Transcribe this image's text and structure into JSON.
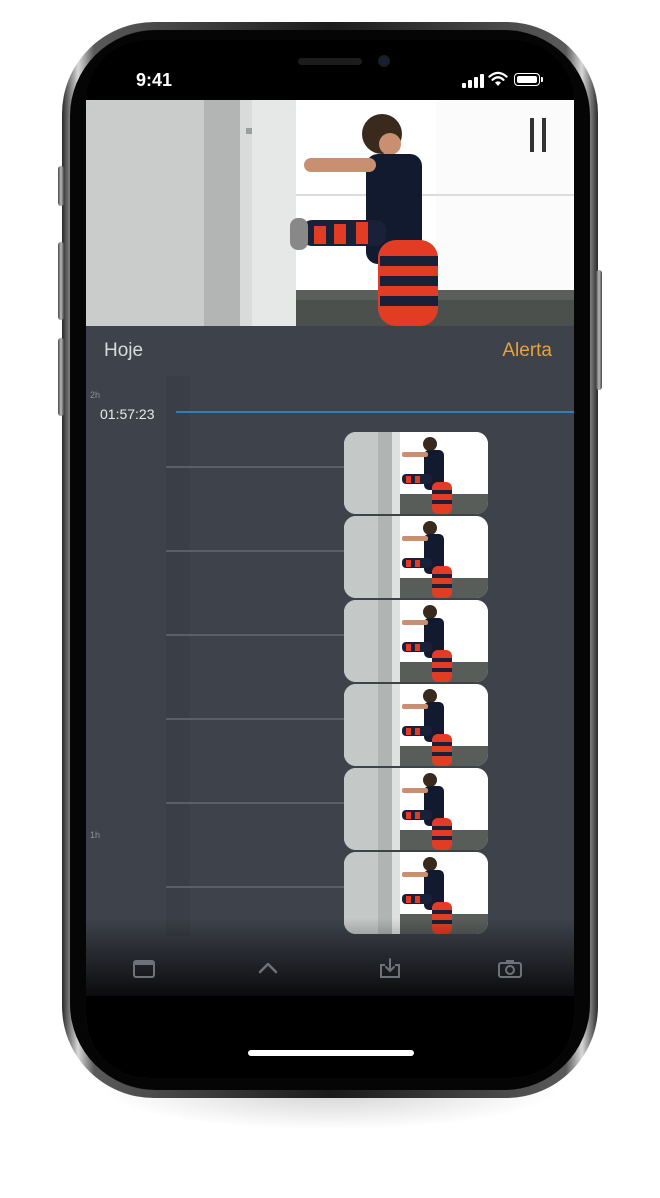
{
  "status_bar": {
    "time": "9:41"
  },
  "timeline": {
    "period_label": "Hoje",
    "alert_label": "Alerta",
    "current_time": "01:57:23",
    "ruler_top_label": "2h",
    "ruler_mid_label": "1h"
  },
  "events": [
    {
      "name": "event-1"
    },
    {
      "name": "event-2"
    },
    {
      "name": "event-3"
    },
    {
      "name": "event-4"
    },
    {
      "name": "event-5"
    },
    {
      "name": "event-6"
    }
  ],
  "tabbar": {
    "icons": [
      "calendar-icon",
      "chevron-up-icon",
      "download-icon",
      "camera-icon"
    ]
  },
  "colors": {
    "accent": "#e9a23b",
    "timeline_line": "#2f7fb5",
    "panel": "#3e424b"
  }
}
